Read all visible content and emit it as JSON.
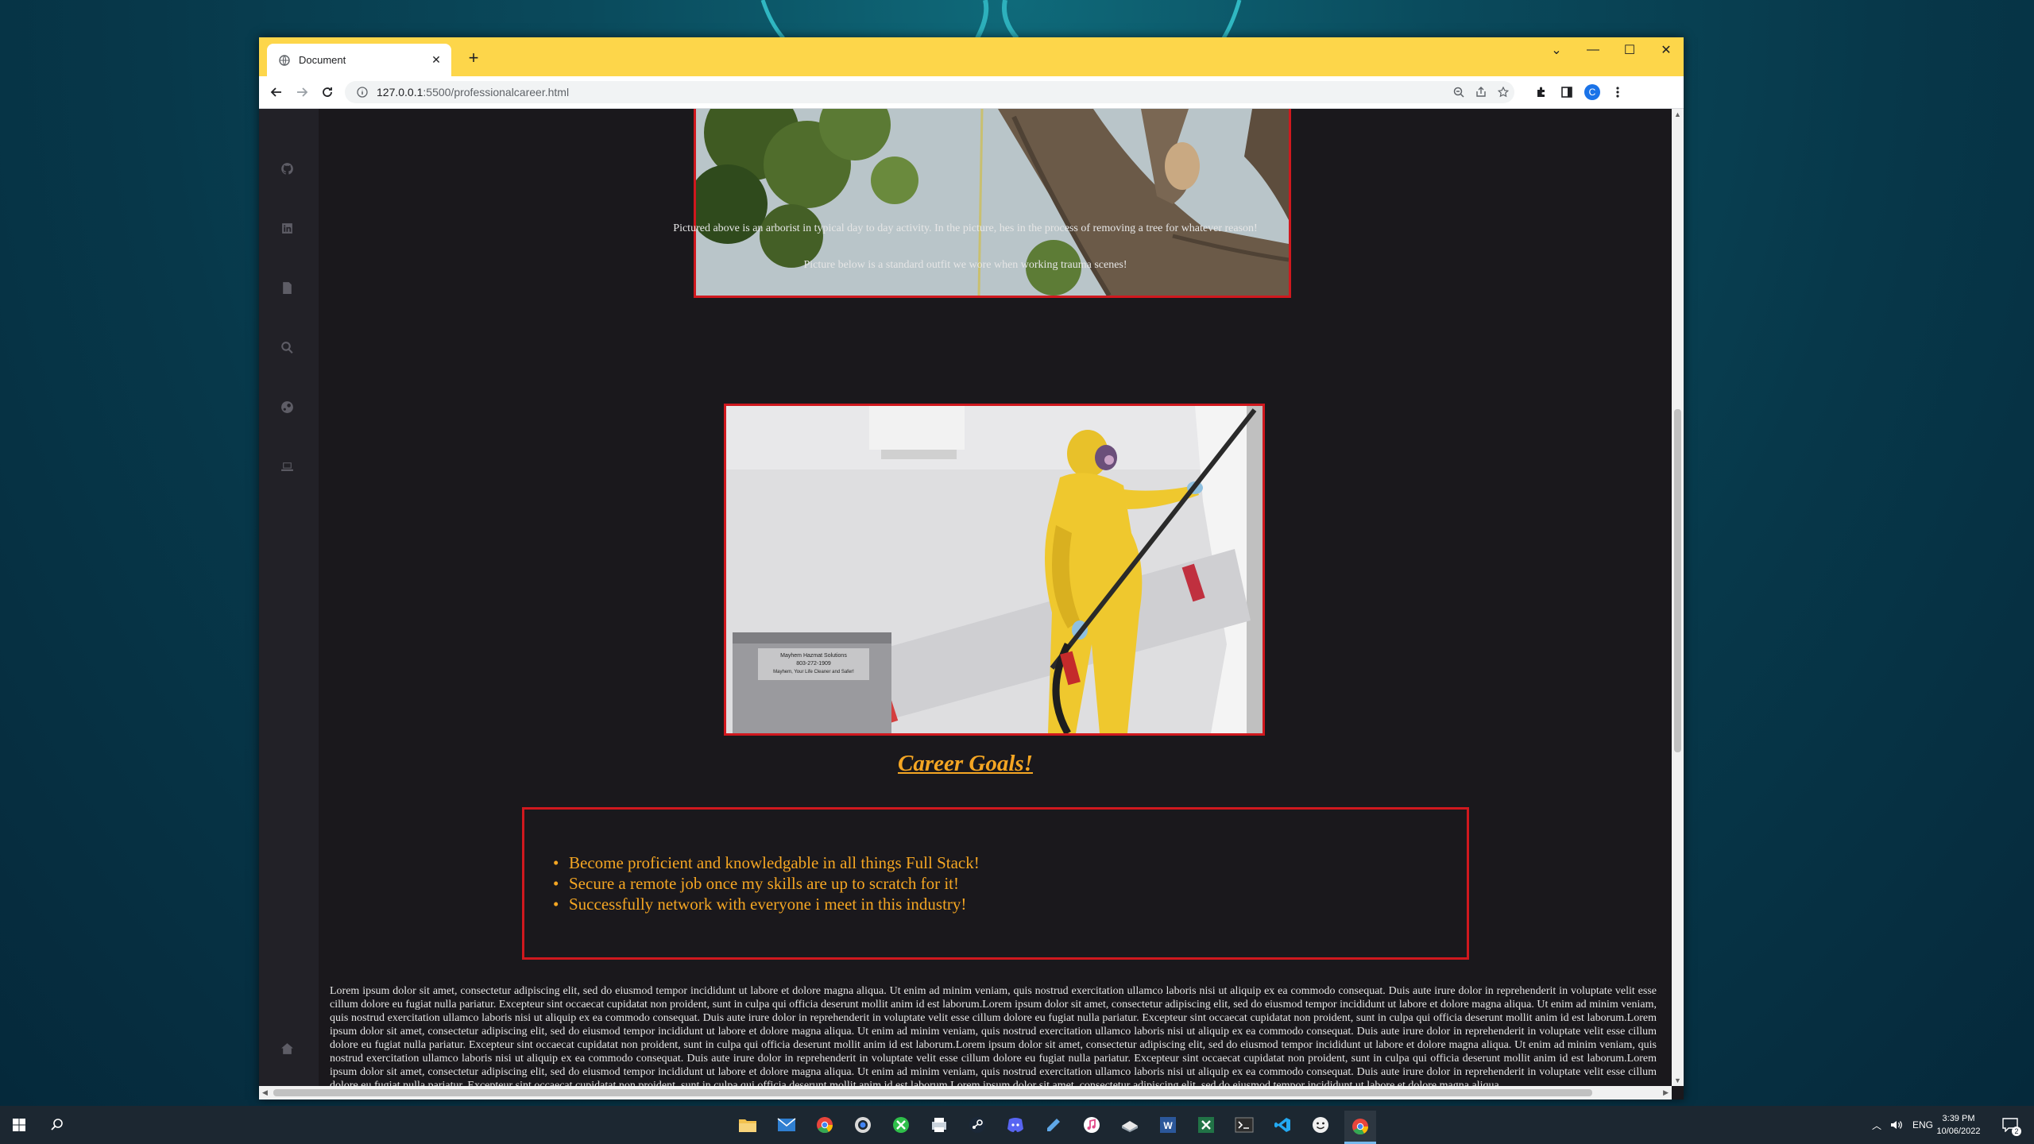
{
  "browser": {
    "tab_title": "Document",
    "url_host": "127.0.0.1",
    "url_path": ":5500/professionalcareer.html",
    "profile_initial": "C"
  },
  "page": {
    "caption_above": "Pictured above is an arborist in typical day to day activity. In the picture, hes in the process of removing a tree for whatever reason!",
    "caption_below": "Picture below is a standard outfit we wore when working trauma scenes!",
    "equipment_label_1": "Mayhem Hazmat Solutions",
    "equipment_label_2": "803-272-1909",
    "equipment_label_3": "Mayhem, Your Life Cleaner and Safer!",
    "goals_title": "Career Goals!",
    "goals": [
      "Become proficient and knowledgable in all things Full Stack!",
      "Secure a remote job once my skills are up to scratch for it!",
      "Successfully network with everyone i meet in this industry!"
    ],
    "lorem": "Lorem ipsum dolor sit amet, consectetur adipiscing elit, sed do eiusmod tempor incididunt ut labore et dolore magna aliqua. Ut enim ad minim veniam, quis nostrud exercitation ullamco laboris nisi ut aliquip ex ea commodo consequat. Duis aute irure dolor in reprehenderit in voluptate velit esse cillum dolore eu fugiat nulla pariatur. Excepteur sint occaecat cupidatat non proident, sunt in culpa qui officia deserunt mollit anim id est laborum.Lorem ipsum dolor sit amet, consectetur adipiscing elit, sed do eiusmod tempor incididunt ut labore et dolore magna aliqua. Ut enim ad minim veniam, quis nostrud exercitation ullamco laboris nisi ut aliquip ex ea commodo consequat. Duis aute irure dolor in reprehenderit in voluptate velit esse cillum dolore eu fugiat nulla pariatur. Excepteur sint occaecat cupidatat non proident, sunt in culpa qui officia deserunt mollit anim id est laborum.Lorem ipsum dolor sit amet, consectetur adipiscing elit, sed do eiusmod tempor incididunt ut labore et dolore magna aliqua. Ut enim ad minim veniam, quis nostrud exercitation ullamco laboris nisi ut aliquip ex ea commodo consequat. Duis aute irure dolor in reprehenderit in voluptate velit esse cillum dolore eu fugiat nulla pariatur. Excepteur sint occaecat cupidatat non proident, sunt in culpa qui officia deserunt mollit anim id est laborum.Lorem ipsum dolor sit amet, consectetur adipiscing elit, sed do eiusmod tempor incididunt ut labore et dolore magna aliqua. Ut enim ad minim veniam, quis nostrud exercitation ullamco laboris nisi ut aliquip ex ea commodo consequat. Duis aute irure dolor in reprehenderit in voluptate velit esse cillum dolore eu fugiat nulla pariatur. Excepteur sint occaecat cupidatat non proident, sunt in culpa qui officia deserunt mollit anim id est laborum.Lorem ipsum dolor sit amet, consectetur adipiscing elit, sed do eiusmod tempor incididunt ut labore et dolore magna aliqua. Ut enim ad minim veniam, quis nostrud exercitation ullamco laboris nisi ut aliquip ex ea commodo consequat. Duis aute irure dolor in reprehenderit in voluptate velit esse cillum dolore eu fugiat nulla pariatur. Excepteur sint occaecat cupidatat non proident, sunt in culpa qui officia deserunt mollit anim id est laborum.Lorem ipsum dolor sit amet, consectetur adipiscing elit, sed do eiusmod tempor incididunt ut labore et dolore magna aliqua.",
    "colors": {
      "accent": "#f5a623",
      "border": "#d0181e",
      "background": "#1a181c"
    }
  },
  "sidebar": {
    "icons": [
      "github-icon",
      "linkedin-icon",
      "document-icon",
      "search-icon",
      "steam-icon",
      "laptop-icon",
      "home-icon"
    ]
  },
  "taskbar": {
    "time": "3:39 PM",
    "date": "10/06/2022",
    "language": "ENG",
    "notifications": "2"
  }
}
